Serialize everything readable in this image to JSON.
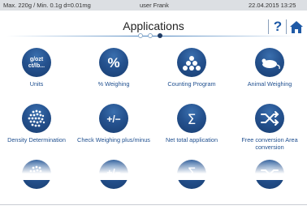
{
  "status": {
    "balance_info": "Max. 220g / Min. 0.1g  d=0.01mg",
    "user": "user Frank",
    "datetime": "22.04.2015  13:25"
  },
  "header": {
    "title": "Applications",
    "help_label": "?"
  },
  "apps": [
    {
      "label": "Units",
      "icon_text": "g/ozt ct/lb..."
    },
    {
      "label": "%  Weighing",
      "icon_text": "%"
    },
    {
      "label": "Counting Program"
    },
    {
      "label": "Animal Weighing"
    },
    {
      "label": "Density Determination"
    },
    {
      "label": "Check Weighing plus/minus",
      "icon_text": "+/−"
    },
    {
      "label": "Net total application",
      "icon_text": "Σ"
    },
    {
      "label": "Free conversion Area conversion"
    }
  ],
  "colors": {
    "accent": "#1f5aa6",
    "icon_bg": "#25528f",
    "status_bg": "#dcdfe3"
  }
}
